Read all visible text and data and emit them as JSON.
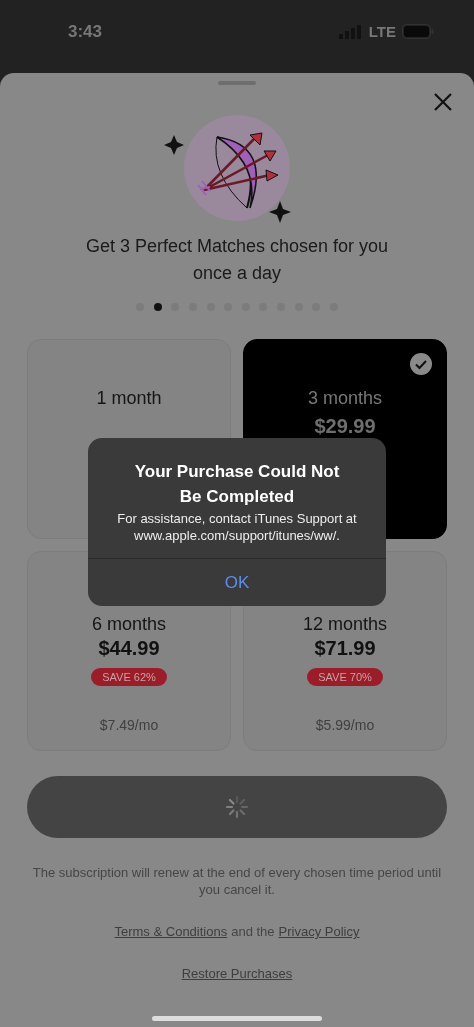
{
  "status_bar": {
    "time": "3:43",
    "network": "LTE"
  },
  "sheet": {
    "headline": "Get 3 Perfect Matches chosen for you once a day",
    "pager": [
      {
        "selected": false
      },
      {
        "selected": true
      },
      {
        "selected": false
      },
      {
        "selected": false
      },
      {
        "selected": false
      },
      {
        "selected": false
      },
      {
        "selected": false
      },
      {
        "selected": false
      },
      {
        "selected": false
      },
      {
        "selected": false
      },
      {
        "selected": false
      },
      {
        "selected": false
      }
    ],
    "plans": [
      {
        "duration": "1 month",
        "selected": false
      },
      {
        "duration": "3 months",
        "price": "$29.99",
        "selected": true
      },
      {
        "duration": "6 months",
        "price": "$44.99",
        "badge": "SAVE 62%",
        "per_month": "$7.49/mo",
        "selected": false
      },
      {
        "duration": "12 months",
        "price": "$71.99",
        "badge": "SAVE 70%",
        "per_month": "$5.99/mo",
        "selected": false
      }
    ],
    "purchase_button": {
      "loading": true
    },
    "disclaimer": "The subscription will renew at the end of every chosen time period until you cancel it.",
    "legal": {
      "terms": "Terms & Conditions",
      "joiner": "and the",
      "privacy": "Privacy Policy"
    },
    "restore": "Restore Purchases"
  },
  "alert": {
    "title": "Your Purchase Could Not Be Completed",
    "message": "For assistance, contact iTunes Support at www.apple.com/support/itunes/ww/.",
    "button": "OK"
  }
}
